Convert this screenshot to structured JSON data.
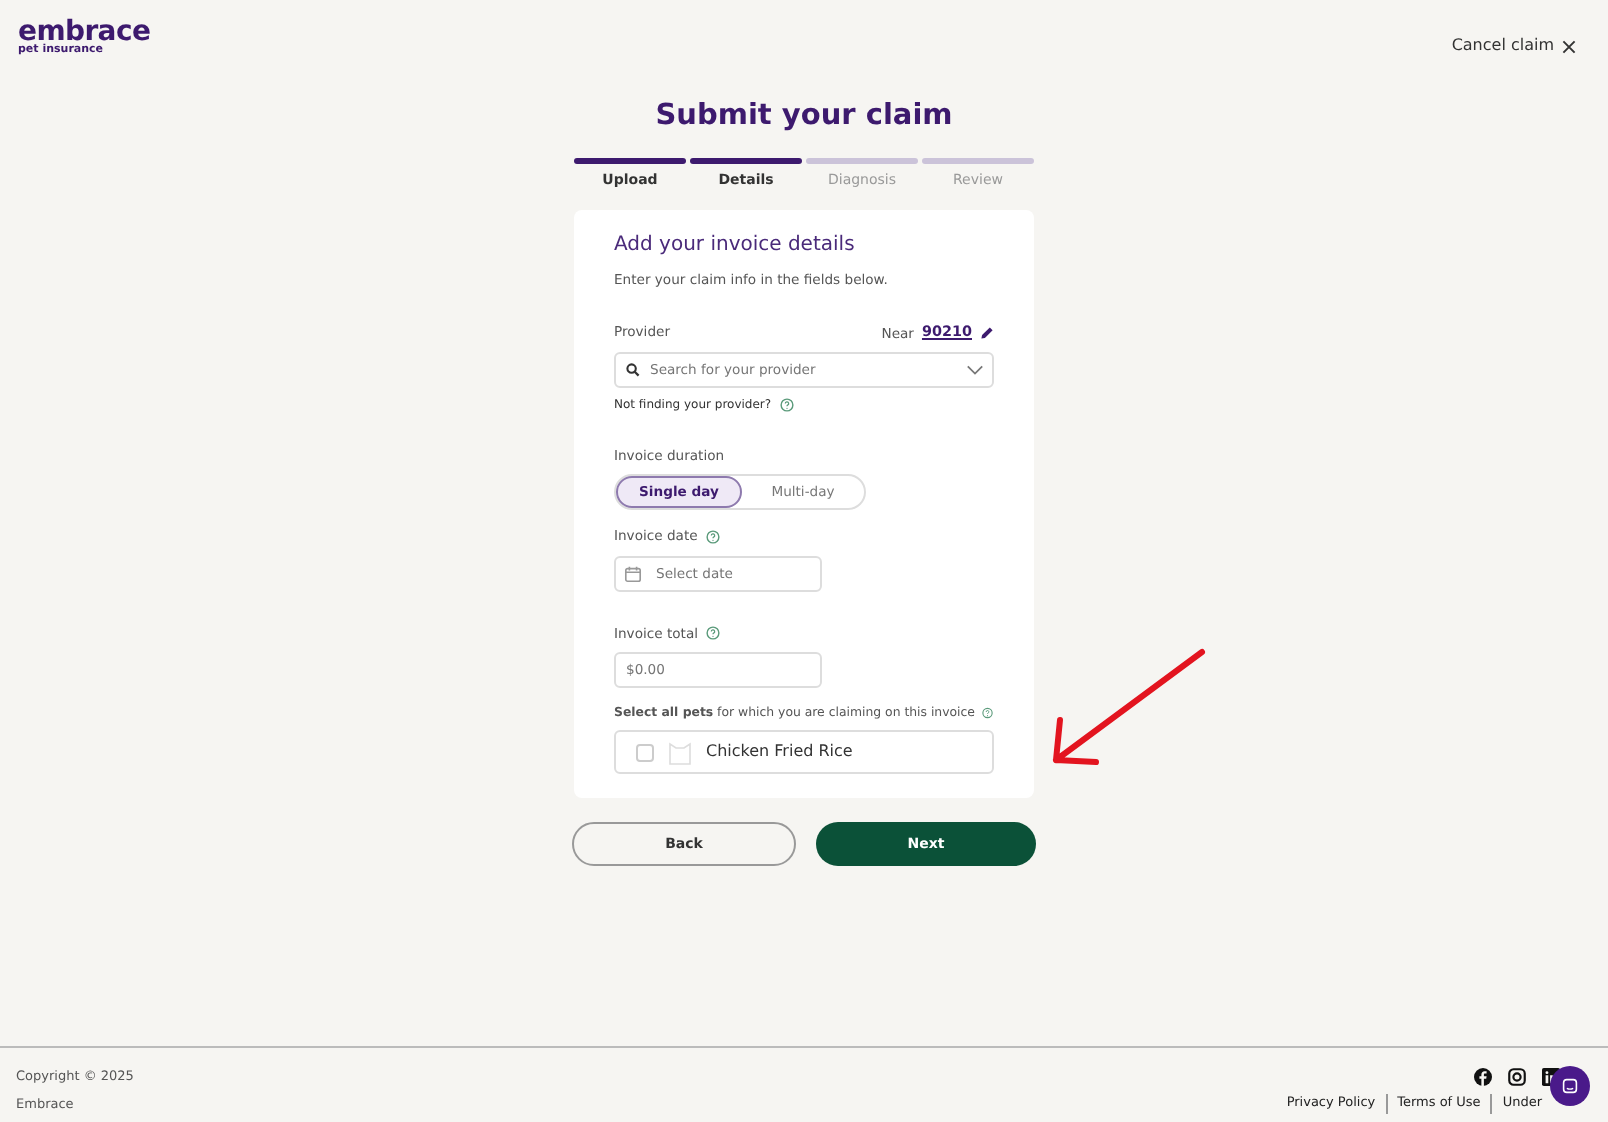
{
  "header": {
    "logo": "embrace",
    "logo_tagline": "pet insurance",
    "cancel": "Cancel claim"
  },
  "title": "Submit your claim",
  "steps": [
    {
      "label": "Upload",
      "completed": true
    },
    {
      "label": "Details",
      "completed": true
    },
    {
      "label": "Diagnosis",
      "completed": false
    },
    {
      "label": "Review",
      "completed": false
    }
  ],
  "form": {
    "heading": "Add your invoice details",
    "intro": "Enter your claim info in the fields below.",
    "provider": {
      "label": "Provider",
      "near_label": "Near",
      "zip": "90210",
      "placeholder": "Search for your provider",
      "help": "Not finding your provider?"
    },
    "duration": {
      "label": "Invoice duration",
      "options": [
        {
          "label": "Single day",
          "selected": true
        },
        {
          "label": "Multi-day",
          "selected": false
        }
      ]
    },
    "date": {
      "label": "Invoice date",
      "placeholder": "Select date"
    },
    "total": {
      "label": "Invoice total",
      "placeholder": "$0.00"
    },
    "pets_label": "**Select all pets** for which you are claiming on this invoice",
    "pets": [
      {
        "name": "Chicken Fried Rice",
        "checked": false
      }
    ]
  },
  "buttons": {
    "back": "Back",
    "next": "Next"
  },
  "footer": {
    "copyright": "Copyright © 2025",
    "company": "Embrace",
    "links": [
      "Privacy Policy",
      "Terms of Use",
      "Under"
    ]
  }
}
